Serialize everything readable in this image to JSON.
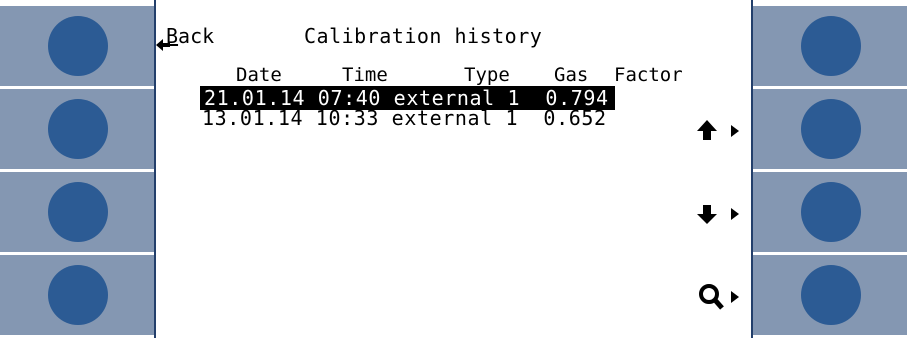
{
  "screen": {
    "back_label": "ack",
    "back_letter": "B",
    "title": "Calibration history",
    "columns": [
      "Date",
      "Time",
      "Type",
      "Gas",
      "Factor"
    ],
    "rows": [
      {
        "date": "21.01.14",
        "time": "07:40",
        "type": "external",
        "gas": "1",
        "factor": "0.794",
        "selected": true
      },
      {
        "date": "13.01.14",
        "time": "10:33",
        "type": "external",
        "gas": "1",
        "factor": "0.652",
        "selected": false
      }
    ]
  },
  "softkeys": [
    "up-arrow-icon",
    "down-arrow-icon",
    "zoom-icon"
  ],
  "colors": {
    "key_bg": "#8497b2",
    "key_circle": "#2c5b94",
    "bezel": "#233f6b"
  }
}
